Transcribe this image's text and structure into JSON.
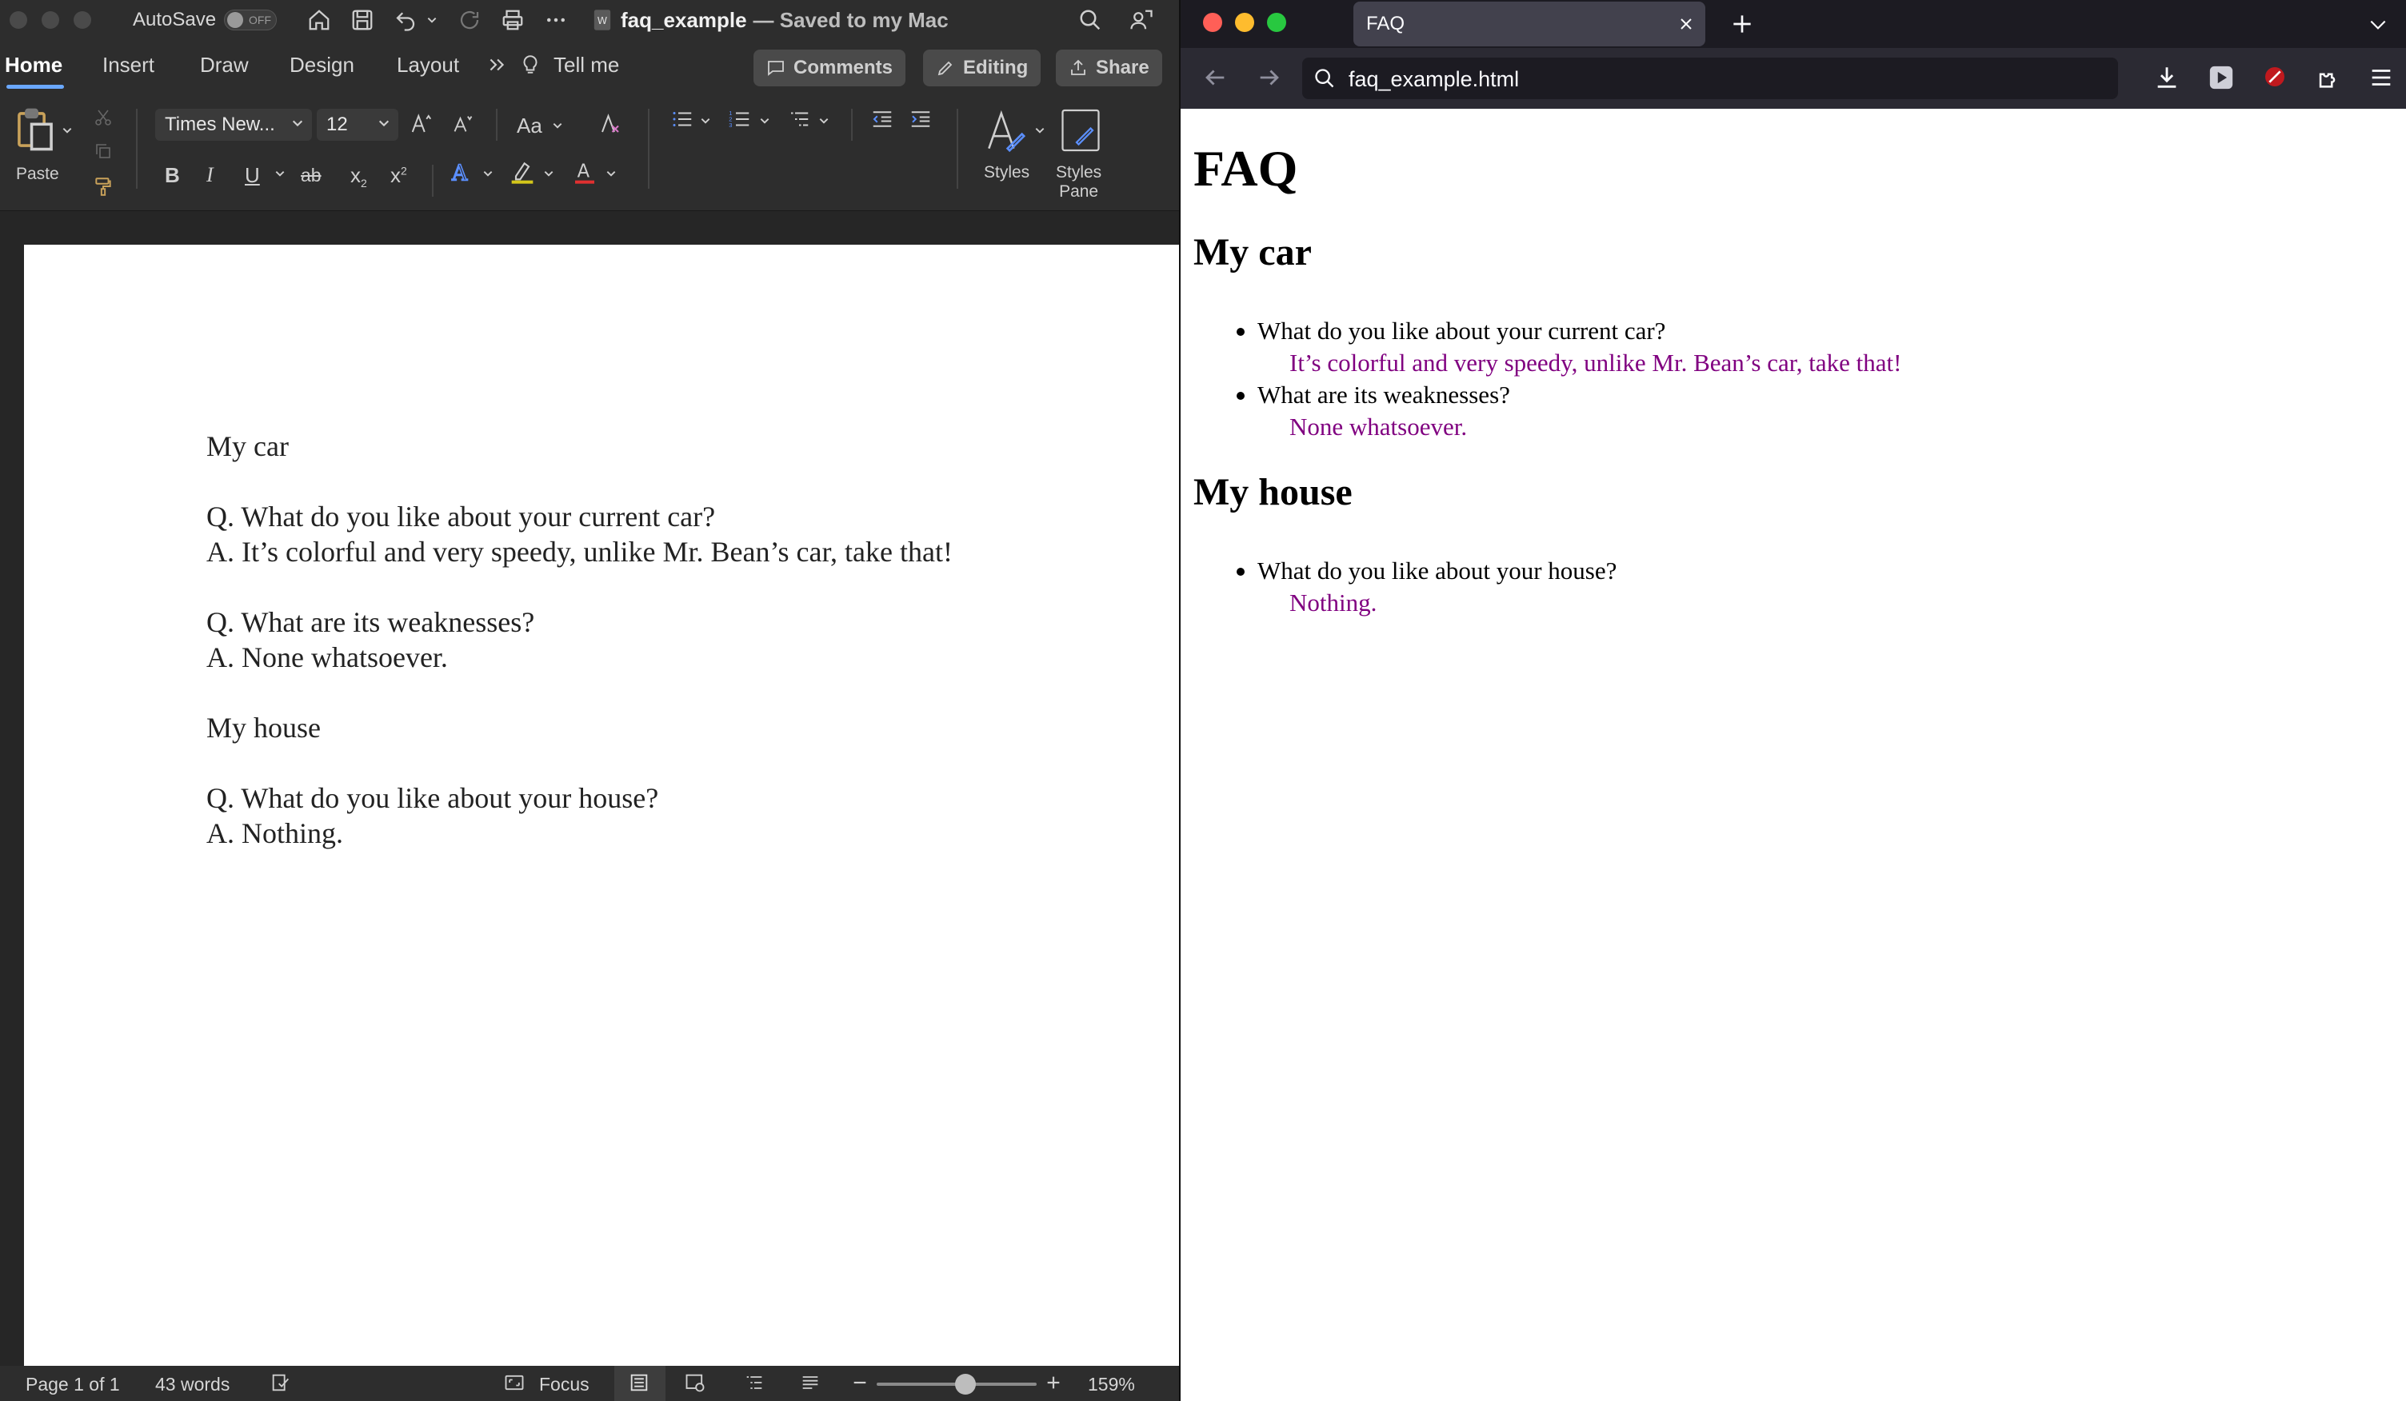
{
  "word": {
    "title_bar": {
      "autosave_label": "AutoSave",
      "autosave_state": "OFF",
      "doc_name": "faq_example",
      "doc_status": "— Saved to my Mac"
    },
    "tabs": [
      "Home",
      "Insert",
      "Draw",
      "Design",
      "Layout"
    ],
    "tell_me": "Tell me",
    "buttons": {
      "comments": "Comments",
      "editing": "Editing",
      "share": "Share"
    },
    "ribbon": {
      "paste_label": "Paste",
      "font_name": "Times New...",
      "font_size": "12",
      "bold": "B",
      "italic": "I",
      "underline": "U",
      "strike": "ab",
      "subscript": "x",
      "superscript": "x",
      "change_case": "Aa",
      "styles_label": "Styles",
      "styles_pane_label_1": "Styles",
      "styles_pane_label_2": "Pane"
    },
    "document": {
      "lines": [
        "My car",
        "",
        "Q. What do you like about your current car?",
        "A. It’s colorful and very speedy, unlike Mr. Bean’s car, take that!",
        "",
        "Q. What are its weaknesses?",
        "A. None whatsoever.",
        "",
        "My house",
        "",
        "Q. What do you like about your house?",
        "A. Nothing."
      ]
    },
    "status_bar": {
      "page": "Page 1 of 1",
      "words": "43 words",
      "focus": "Focus",
      "zoom": "159%"
    }
  },
  "browser": {
    "tab_title": "FAQ",
    "url": "faq_example.html",
    "page": {
      "h1": "FAQ",
      "sections": [
        {
          "heading": "My car",
          "items": [
            {
              "q": "What do you like about your current car?",
              "a": "It’s colorful and very speedy, unlike Mr. Bean’s car, take that!"
            },
            {
              "q": "What are its weaknesses?",
              "a": "None whatsoever."
            }
          ]
        },
        {
          "heading": "My house",
          "items": [
            {
              "q": "What do you like about your house?",
              "a": "Nothing."
            }
          ]
        }
      ]
    },
    "colors": {
      "answer": "#800080",
      "close": "#ff5f57",
      "minimize": "#febc2e",
      "zoom": "#28c840"
    }
  }
}
